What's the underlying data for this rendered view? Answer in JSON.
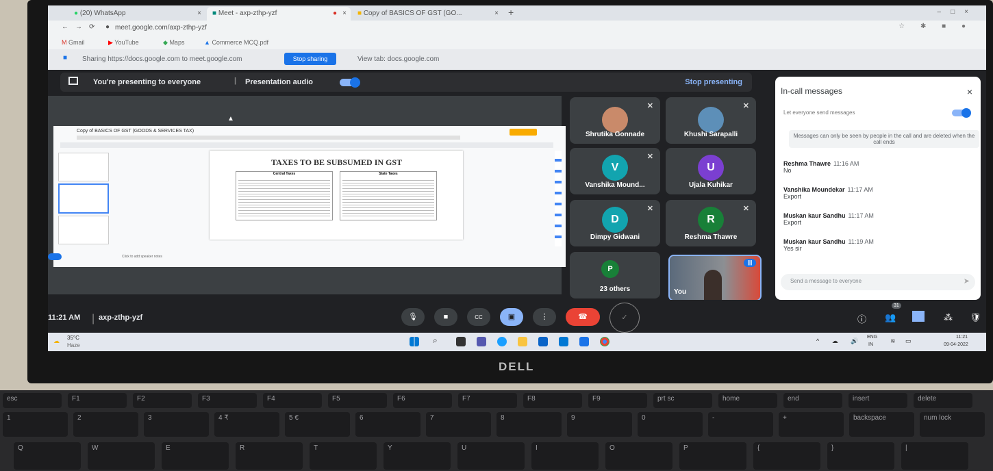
{
  "browser": {
    "tabs": [
      {
        "label": "(20) WhatsApp"
      },
      {
        "label": "Meet - axp-zthp-yzf"
      },
      {
        "label": "Copy of BASICS OF GST (GO..."
      }
    ],
    "url": "meet.google.com/axp-zthp-yzf",
    "bookmarks": [
      "Gmail",
      "YouTube",
      "Maps",
      "Commerce MCQ.pdf"
    ],
    "share_text": "Sharing https://docs.google.com to meet.google.com",
    "stop_sharing": "Stop sharing",
    "view_tab": "View tab: docs.google.com"
  },
  "meet": {
    "presenting_text": "You're presenting to everyone",
    "presentation_audio": "Presentation audio",
    "stop_presenting": "Stop presenting",
    "time": "11:21 AM",
    "meeting_code": "axp-zthp-yzf",
    "participants_badge": "31",
    "participants": [
      {
        "name": "Shrutika Gonnade",
        "initial": "",
        "color": "#c98a6a"
      },
      {
        "name": "Khushi Sarapalli",
        "initial": "",
        "color": "#5d8fb8"
      },
      {
        "name": "Vanshika Mound...",
        "initial": "V",
        "color": "#12a4af"
      },
      {
        "name": "Ujala Kuhikar",
        "initial": "U",
        "color": "#7b3fd1"
      },
      {
        "name": "Dimpy Gidwani",
        "initial": "D",
        "color": "#12a4af"
      },
      {
        "name": "Reshma Thawre",
        "initial": "R",
        "color": "#188038"
      },
      {
        "name": "23 others",
        "initial": "P",
        "color": "#188038"
      },
      {
        "name": "You",
        "initial": "",
        "color": "#b35a3c"
      }
    ]
  },
  "doc": {
    "title": "Copy of BASICS OF GST (GOODS & SERVICES TAX)",
    "heading": "TAXES TO BE SUBSUMED IN GST",
    "col1": "Central Taxes",
    "col2": "State Taxes",
    "footer": "Click to add speaker notes"
  },
  "chat": {
    "title": "In-call messages",
    "toggle_label": "Let everyone send messages",
    "notice": "Messages can only be seen by people in the call and are deleted when the call ends",
    "messages": [
      {
        "sender": "Reshma Thawre",
        "time": "11:16 AM",
        "text": "No"
      },
      {
        "sender": "Vanshika Moundekar",
        "time": "11:17 AM",
        "text": "Export"
      },
      {
        "sender": "Muskan kaur Sandhu",
        "time": "11:17 AM",
        "text": "Export"
      },
      {
        "sender": "Muskan kaur Sandhu",
        "time": "11:19 AM",
        "text": "Yes sir"
      }
    ],
    "placeholder": "Send a message to everyone"
  },
  "taskbar": {
    "weather_temp": "35°C",
    "weather_desc": "Haze",
    "lang": "ENG",
    "region": "IN",
    "clock": "11:21",
    "date": "09-04-2022"
  },
  "laptop": {
    "brand": "DELL"
  },
  "keys_fn": [
    "esc",
    "F1",
    "F2",
    "F3",
    "F4",
    "F5",
    "F6",
    "F7",
    "F8",
    "F9",
    "prt sc",
    "home",
    "end",
    "insert",
    "delete"
  ],
  "keys_num": [
    "1",
    "2",
    "3",
    "4 ₹",
    "5 €",
    "6",
    "7",
    "8",
    "9",
    "0",
    "-",
    "+",
    "backspace",
    "num lock"
  ],
  "keys_alpha": [
    "Q",
    "W",
    "E",
    "R",
    "T",
    "Y",
    "U",
    "I",
    "O",
    "P",
    "{",
    "}",
    "|"
  ]
}
